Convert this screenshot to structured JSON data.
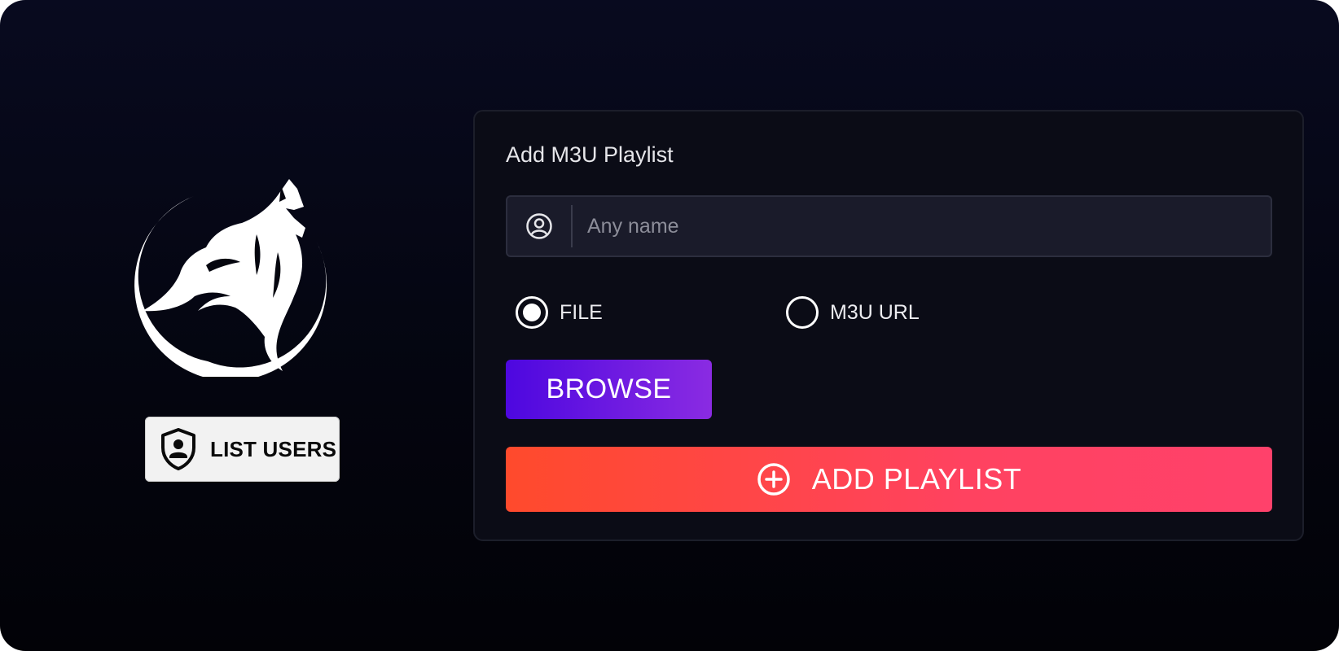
{
  "sidebar": {
    "logo_icon": "wolf-howling-logo",
    "list_users_label": "LIST USERS",
    "list_users_icon": "shield-user-icon"
  },
  "form": {
    "title": "Add M3U Playlist",
    "name_field": {
      "placeholder": "Any name",
      "value": "",
      "icon": "user-circle-icon"
    },
    "source_options": [
      {
        "label": "FILE",
        "selected": true
      },
      {
        "label": "M3U URL",
        "selected": false
      }
    ],
    "browse_label": "BROWSE",
    "add_playlist_label": "ADD PLAYLIST",
    "add_playlist_icon": "plus-circle-icon"
  },
  "colors": {
    "background": "#04050f",
    "browse_gradient": [
      "#4d07e0",
      "#8a2be2"
    ],
    "add_gradient": [
      "#ff4a2c",
      "#ff416b"
    ],
    "card_background": "#0b0c16",
    "input_background": "#1a1b2a"
  }
}
